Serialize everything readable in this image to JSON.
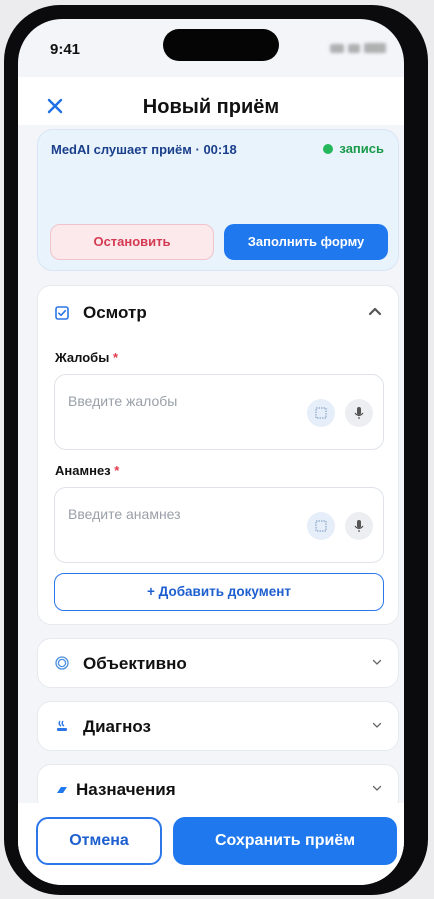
{
  "status_bar": {
    "time": "9:41"
  },
  "header": {
    "close_icon": "close-icon",
    "title": "Новый приём"
  },
  "ai_panel": {
    "status_text": "MedAI слушает приём · 00:18",
    "recording_label": "запись",
    "stop_label": "Остановить",
    "fill_label": "Заполнить форму",
    "colors": {
      "accent": "#1f78ee",
      "recording": "#26b75c",
      "stop": "#d43a52"
    }
  },
  "sections": {
    "exam": {
      "title": "Осмотр",
      "icon": "checkbox-icon",
      "expanded": true,
      "complaints": {
        "label": "Жалобы",
        "required_mark": "*",
        "placeholder": "Введите жалобы"
      },
      "anamnesis": {
        "label": "Анамнез",
        "required_mark": "*",
        "placeholder": "Введите анамнез"
      },
      "add_document_label": "+ Добавить документ"
    },
    "objective": {
      "title": "Объективно",
      "icon": "target-icon",
      "expanded": false
    },
    "diagnosis": {
      "title": "Диагноз",
      "icon": "diagnosis-icon",
      "expanded": false
    },
    "prescriptions": {
      "title": "Назначения",
      "icon": "pill-icon",
      "expanded": false
    }
  },
  "footer": {
    "cancel_label": "Отмена",
    "save_label": "Сохранить приём"
  }
}
